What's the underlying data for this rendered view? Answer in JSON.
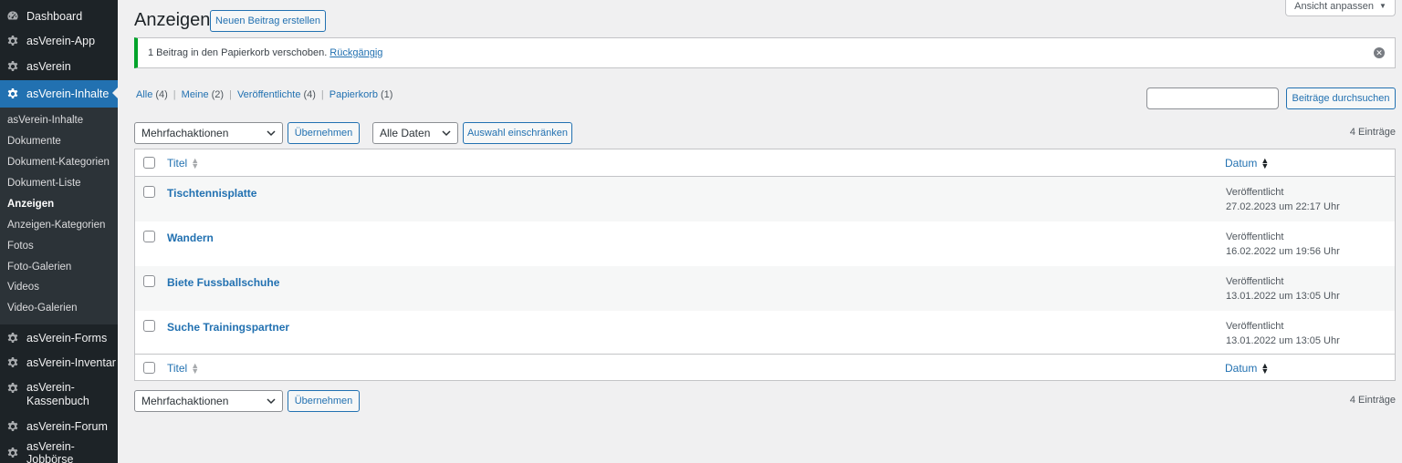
{
  "sidebar": {
    "menu": [
      {
        "label": "Dashboard",
        "icon": "dashboard-icon"
      },
      {
        "label": "asVerein-App",
        "icon": "gear-icon"
      },
      {
        "label": "asVerein",
        "icon": "gear-icon"
      },
      {
        "label": "asVerein-Inhalte",
        "icon": "gear-icon"
      },
      {
        "label": "asVerein-Forms",
        "icon": "gear-icon"
      },
      {
        "label": "asVerein-Inventar",
        "icon": "gear-icon"
      },
      {
        "label": "asVerein-\nKassenbuch",
        "icon": "gear-icon"
      },
      {
        "label": "asVerein-Forum",
        "icon": "gear-icon"
      },
      {
        "label": "asVerein-Jobbörse",
        "icon": "gear-icon"
      }
    ],
    "submenu": [
      "asVerein-Inhalte",
      "Dokumente",
      "Dokument-Kategorien",
      "Dokument-Liste",
      "Anzeigen",
      "Anzeigen-Kategorien",
      "Fotos",
      "Foto-Galerien",
      "Videos",
      "Video-Galerien"
    ]
  },
  "header": {
    "title": "Anzeigen",
    "new_button": "Neuen Beitrag erstellen",
    "screen_options": "Ansicht anpassen"
  },
  "notice": {
    "text": "1 Beitrag in den Papierkorb verschoben.",
    "undo": "Rückgängig"
  },
  "views": [
    {
      "label": "Alle",
      "count": "(4)"
    },
    {
      "label": "Meine",
      "count": "(2)"
    },
    {
      "label": "Veröffentlichte",
      "count": "(4)"
    },
    {
      "label": "Papierkorb",
      "count": "(1)"
    }
  ],
  "search": {
    "value": "",
    "button": "Beiträge durchsuchen"
  },
  "tablenav": {
    "bulk_action": "Mehrfachaktionen",
    "apply": "Übernehmen",
    "date_filter": "Alle Daten",
    "filter_button": "Auswahl einschränken",
    "count": "4 Einträge"
  },
  "table": {
    "col_title": "Titel",
    "col_date": "Datum",
    "rows": [
      {
        "title": "Tischtennisplatte",
        "status": "Veröffentlicht",
        "date": "27.02.2023 um 22:17 Uhr"
      },
      {
        "title": "Wandern",
        "status": "Veröffentlicht",
        "date": "16.02.2022 um 19:56 Uhr"
      },
      {
        "title": "Biete Fussballschuhe",
        "status": "Veröffentlicht",
        "date": "13.01.2022 um 13:05 Uhr"
      },
      {
        "title": "Suche Trainingspartner",
        "status": "Veröffentlicht",
        "date": "13.01.2022 um 13:05 Uhr"
      }
    ]
  },
  "colors": {
    "accent": "#2271b1",
    "sidebar_bg": "#1d2327",
    "submenu_bg": "#2c3338",
    "notice_success": "#00a32a"
  }
}
